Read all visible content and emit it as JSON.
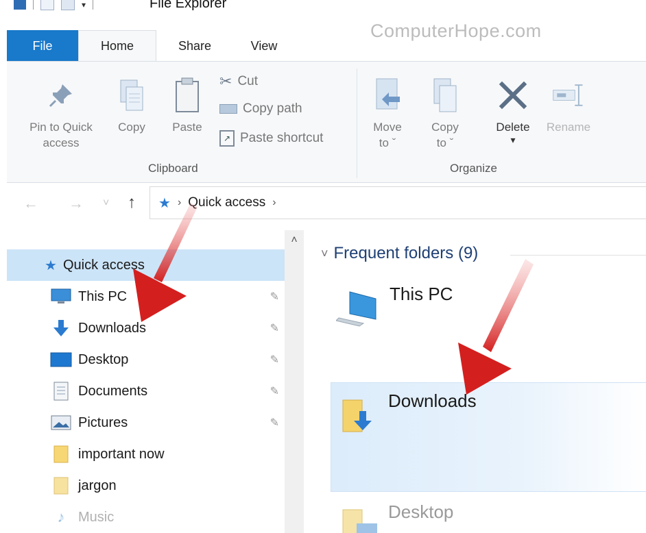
{
  "window": {
    "title": "File Explorer",
    "watermark": "ComputerHope.com"
  },
  "tabs": [
    {
      "label": "File"
    },
    {
      "label": "Home"
    },
    {
      "label": "Share"
    },
    {
      "label": "View"
    }
  ],
  "ribbon": {
    "clipboard": {
      "pin_label": "Pin to Quick",
      "pin_label2": "access",
      "copy_label": "Copy",
      "paste_label": "Paste",
      "cut_label": "Cut",
      "copy_path_label": "Copy path",
      "paste_shortcut_label": "Paste shortcut",
      "group_label": "Clipboard"
    },
    "organize": {
      "move_label": "Move",
      "move_label2": "to ˇ",
      "copy_label": "Copy",
      "copy_label2": "to ˇ",
      "delete_label": "Delete",
      "delete_caret": "▾",
      "rename_label": "Rename",
      "group_label": "Organize"
    }
  },
  "address_bar": {
    "back": "←",
    "forward": "→",
    "recent": "˅",
    "up": "↑",
    "location": "Quick access",
    "sep": "›"
  },
  "sidebar": {
    "scroll_up": "˄",
    "items": [
      {
        "label": "Quick access",
        "icon": "star-icon"
      },
      {
        "label": "This PC",
        "icon": "monitor-icon",
        "pinned": true
      },
      {
        "label": "Downloads",
        "icon": "download-arrow-icon",
        "pinned": true
      },
      {
        "label": "Desktop",
        "icon": "desktop-icon",
        "pinned": true
      },
      {
        "label": "Documents",
        "icon": "documents-icon",
        "pinned": true
      },
      {
        "label": "Pictures",
        "icon": "pictures-icon",
        "pinned": true
      },
      {
        "label": "important now",
        "icon": "folder-icon"
      },
      {
        "label": "jargon",
        "icon": "folder-icon"
      },
      {
        "label": "Music",
        "icon": "music-note-icon"
      }
    ],
    "pin_glyph": "📌"
  },
  "content": {
    "header": "Frequent folders (9)",
    "chevron": "˅",
    "tiles": [
      {
        "label": "This PC"
      },
      {
        "label": "Downloads"
      },
      {
        "label": "Desktop"
      }
    ]
  },
  "colors": {
    "file_tab": "#1979ca",
    "selection": "#cce4f7",
    "header_text": "#1e3f74",
    "annotation_arrow": "#d41f1f"
  }
}
